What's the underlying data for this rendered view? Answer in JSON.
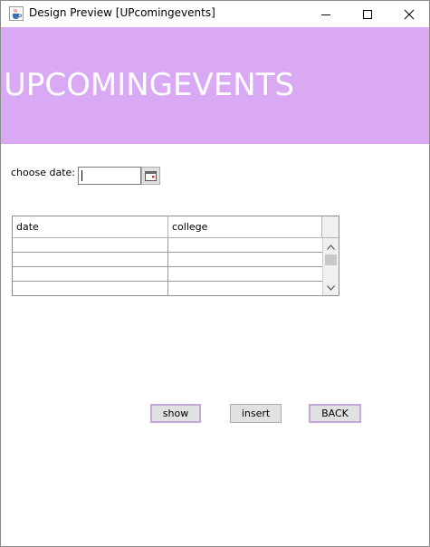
{
  "window": {
    "title": "Design Preview [UPcomingevents]"
  },
  "banner": {
    "title": "UPCOMINGEVENTS",
    "background_color": "#d9a9f3"
  },
  "form": {
    "choose_date_label": "choose date:",
    "date_value": ""
  },
  "table": {
    "columns": [
      "date",
      "college"
    ],
    "rows": [
      [
        "",
        ""
      ],
      [
        "",
        ""
      ],
      [
        "",
        ""
      ],
      [
        "",
        ""
      ]
    ]
  },
  "buttons": {
    "show_label": "show",
    "insert_label": "insert",
    "back_label": "BACK"
  },
  "icons": {
    "app_icon": "java-cup-icon",
    "calendar_icon": "calendar-icon"
  }
}
